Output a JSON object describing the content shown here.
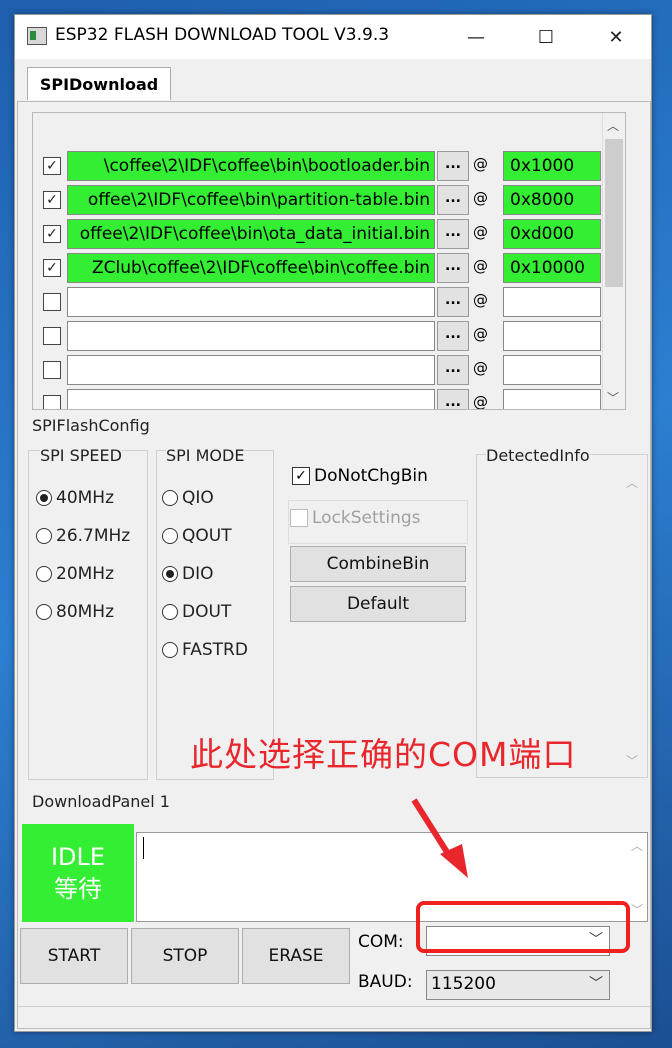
{
  "window": {
    "title": "ESP32 FLASH DOWNLOAD TOOL V3.9.3",
    "minimize": "—",
    "maximize": "☐",
    "close": "✕"
  },
  "tab": {
    "label": "SPIDownload"
  },
  "files": [
    {
      "checked": "✓",
      "path": "\\coffee\\2\\IDF\\coffee\\bin\\bootloader.bin",
      "dots": "...",
      "at": "@",
      "addr": "0x1000"
    },
    {
      "checked": "✓",
      "path": "offee\\2\\IDF\\coffee\\bin\\partition-table.bin",
      "dots": "...",
      "at": "@",
      "addr": "0x8000"
    },
    {
      "checked": "✓",
      "path": "offee\\2\\IDF\\coffee\\bin\\ota_data_initial.bin",
      "dots": "...",
      "at": "@",
      "addr": "0xd000"
    },
    {
      "checked": "✓",
      "path": "ZClub\\coffee\\2\\IDF\\coffee\\bin\\coffee.bin",
      "dots": "...",
      "at": "@",
      "addr": "0x10000"
    },
    {
      "checked": "",
      "path": "",
      "dots": "...",
      "at": "@",
      "addr": ""
    },
    {
      "checked": "",
      "path": "",
      "dots": "...",
      "at": "@",
      "addr": ""
    },
    {
      "checked": "",
      "path": "",
      "dots": "...",
      "at": "@",
      "addr": ""
    },
    {
      "checked": "",
      "path": "",
      "dots": "...",
      "at": "@",
      "addr": ""
    }
  ],
  "flashconfig": {
    "label": "SPIFlashConfig",
    "speed_label": "SPI SPEED",
    "speeds": [
      "40MHz",
      "26.7MHz",
      "20MHz",
      "80MHz"
    ],
    "mode_label": "SPI MODE",
    "modes": [
      "QIO",
      "QOUT",
      "DIO",
      "DOUT",
      "FASTRD"
    ],
    "donotchg": "DoNotChgBin",
    "locksettings": "LockSettings",
    "combine": "CombineBin",
    "default": "Default",
    "detected": "DetectedInfo"
  },
  "annotation": "此处选择正确的COM端口",
  "download": {
    "label": "DownloadPanel 1",
    "status_en": "IDLE",
    "status_cn": "等待",
    "start": "START",
    "stop": "STOP",
    "erase": "ERASE",
    "com_label": "COM:",
    "com_value": "",
    "baud_label": "BAUD:",
    "baud_value": "115200"
  },
  "colors": {
    "active_green": "#33ee33",
    "annotation_red": "#e8262c"
  }
}
